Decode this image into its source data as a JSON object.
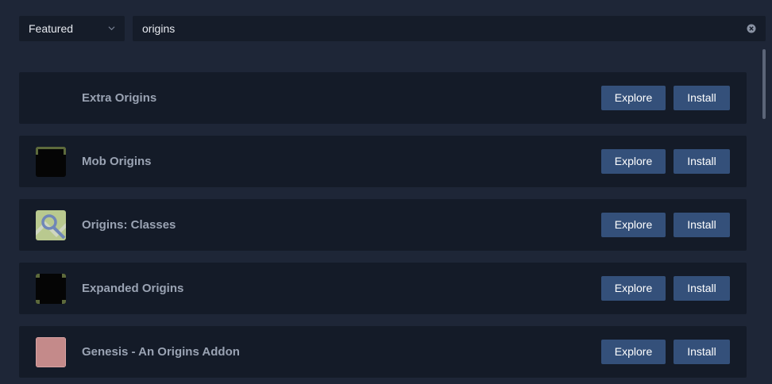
{
  "filter": {
    "selected": "Featured"
  },
  "search": {
    "value": "origins"
  },
  "explore_label": "Explore",
  "install_label": "Install",
  "mods": [
    {
      "name": "Extra Origins",
      "icon": "none"
    },
    {
      "name": "Mob Origins",
      "icon": "mob-origins-icon"
    },
    {
      "name": "Origins: Classes",
      "icon": "origins-classes-icon"
    },
    {
      "name": "Expanded Origins",
      "icon": "expanded-origins-icon"
    },
    {
      "name": "Genesis - An Origins Addon",
      "icon": "genesis-icon"
    }
  ],
  "colors": {
    "background": "#1e2637",
    "card": "#141b28",
    "button": "#34507a",
    "text_muted": "#9aa3b3"
  }
}
